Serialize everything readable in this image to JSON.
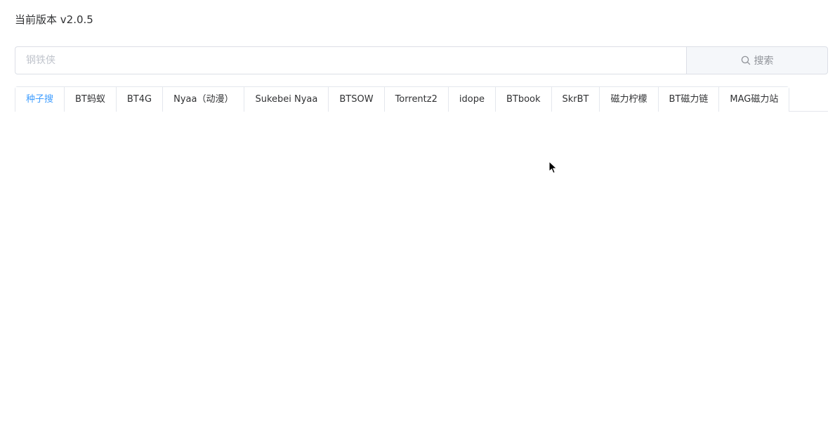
{
  "header": {
    "version_text": "当前版本 v2.0.5"
  },
  "search": {
    "placeholder": "钢铁侠",
    "value": "",
    "button_label": "搜索",
    "button_icon": "search-icon"
  },
  "tabs": {
    "active_index": 0,
    "items": [
      {
        "label": "种子搜"
      },
      {
        "label": "BT蚂蚁"
      },
      {
        "label": "BT4G"
      },
      {
        "label": "Nyaa（动漫）"
      },
      {
        "label": "Sukebei Nyaa"
      },
      {
        "label": "BTSOW"
      },
      {
        "label": "Torrentz2"
      },
      {
        "label": "idope"
      },
      {
        "label": "BTbook"
      },
      {
        "label": "SkrBT"
      },
      {
        "label": "磁力柠檬"
      },
      {
        "label": "BT磁力链"
      },
      {
        "label": "MAG磁力站"
      }
    ]
  },
  "colors": {
    "accent": "#409eff",
    "border": "#dcdfe6",
    "button_bg": "#f5f7fa",
    "text": "#303133",
    "placeholder": "#c0c4cc"
  }
}
